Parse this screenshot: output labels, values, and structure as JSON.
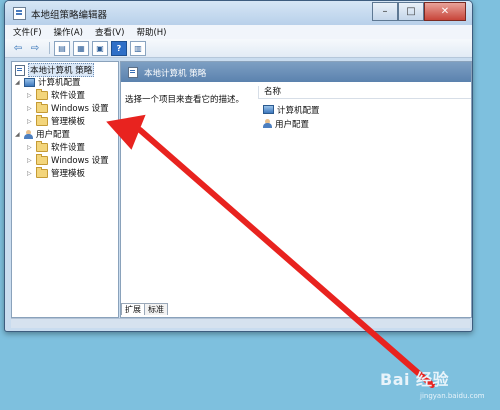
{
  "window": {
    "title": "本地组策略编辑器",
    "controls": {
      "minimize": "–",
      "maximize": "□",
      "close": "✕"
    }
  },
  "menu": [
    "文件(F)",
    "操作(A)",
    "查看(V)",
    "帮助(H)"
  ],
  "toolbar": {
    "icons": [
      "back-arrow-icon",
      "forward-arrow-icon",
      "show-tree-icon",
      "export-list-icon",
      "properties-icon",
      "help-icon",
      "view-icon"
    ]
  },
  "tree": {
    "root": "本地计算机 策略",
    "computer_config": {
      "label": "计算机配置",
      "children": [
        "软件设置",
        "Windows 设置",
        "管理模板"
      ]
    },
    "user_config": {
      "label": "用户配置",
      "children": [
        "软件设置",
        "Windows 设置",
        "管理模板"
      ]
    }
  },
  "details": {
    "title": "本地计算机 策略",
    "description": "选择一个项目来查看它的描述。",
    "column_header": "名称",
    "items": [
      "计算机配置",
      "用户配置"
    ],
    "tabs": [
      "扩展",
      "标准"
    ]
  },
  "overlay": {
    "arrow_color": "#e8231f",
    "watermark": "Bai 经验",
    "watermark_sub": "jingyan.baidu.com"
  }
}
